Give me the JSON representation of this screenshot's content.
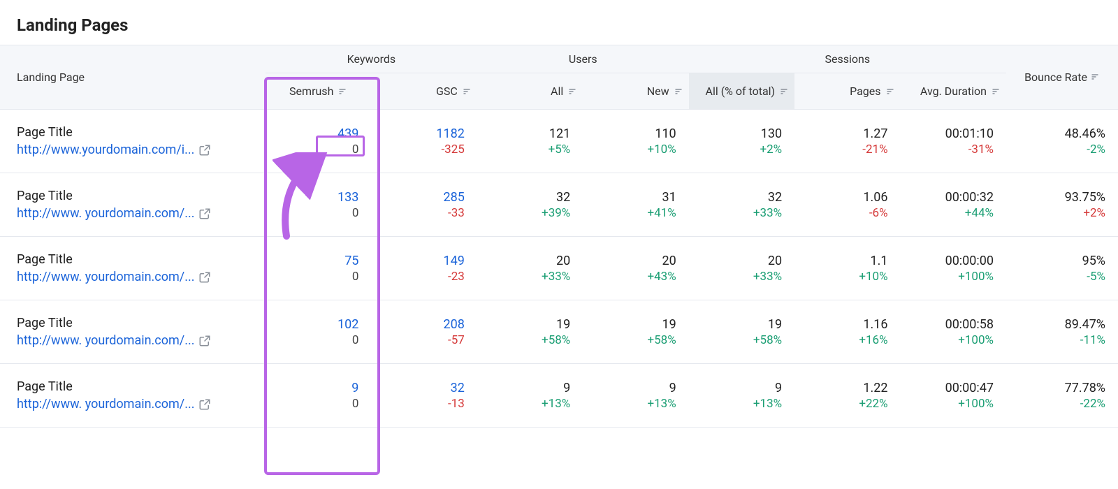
{
  "title": "Landing Pages",
  "headers": {
    "landing": "Landing Page",
    "keywords_group": "Keywords",
    "users_group": "Users",
    "sessions_group": "Sessions",
    "bounce": "Bounce Rate",
    "semrush": "Semrush",
    "gsc": "GSC",
    "users_all": "All",
    "users_new": "New",
    "sess_all": "All (% of total)",
    "sess_pages": "Pages",
    "sess_dur": "Avg. Duration"
  },
  "rows": [
    {
      "title": "Page Title",
      "url": "http://www.yourdomain.com/i...",
      "semrush": {
        "v": "439",
        "d": "0",
        "dc": "neutral"
      },
      "gsc": {
        "v": "1182",
        "d": "-325",
        "dc": "neg"
      },
      "users_all": {
        "v": "121",
        "d": "+5%",
        "dc": "pos"
      },
      "users_new": {
        "v": "110",
        "d": "+10%",
        "dc": "pos"
      },
      "sess_all": {
        "v": "130",
        "d": "+2%",
        "dc": "pos"
      },
      "pages": {
        "v": "1.27",
        "d": "-21%",
        "dc": "neg"
      },
      "dur": {
        "v": "00:01:10",
        "d": "-31%",
        "dc": "neg"
      },
      "bounce": {
        "v": "48.46%",
        "d": "-2%",
        "dc": "pos"
      }
    },
    {
      "title": "Page Title",
      "url": "http://www. yourdomain.com/...",
      "semrush": {
        "v": "133",
        "d": "0",
        "dc": "neutral"
      },
      "gsc": {
        "v": "285",
        "d": "-33",
        "dc": "neg"
      },
      "users_all": {
        "v": "32",
        "d": "+39%",
        "dc": "pos"
      },
      "users_new": {
        "v": "31",
        "d": "+41%",
        "dc": "pos"
      },
      "sess_all": {
        "v": "32",
        "d": "+33%",
        "dc": "pos"
      },
      "pages": {
        "v": "1.06",
        "d": "-6%",
        "dc": "neg"
      },
      "dur": {
        "v": "00:00:32",
        "d": "+44%",
        "dc": "pos"
      },
      "bounce": {
        "v": "93.75%",
        "d": "+2%",
        "dc": "neg"
      }
    },
    {
      "title": "Page Title",
      "url": "http://www. yourdomain.com/...",
      "semrush": {
        "v": "75",
        "d": "0",
        "dc": "neutral"
      },
      "gsc": {
        "v": "149",
        "d": "-23",
        "dc": "neg"
      },
      "users_all": {
        "v": "20",
        "d": "+33%",
        "dc": "pos"
      },
      "users_new": {
        "v": "20",
        "d": "+43%",
        "dc": "pos"
      },
      "sess_all": {
        "v": "20",
        "d": "+33%",
        "dc": "pos"
      },
      "pages": {
        "v": "1.1",
        "d": "+10%",
        "dc": "pos"
      },
      "dur": {
        "v": "00:00:00",
        "d": "+100%",
        "dc": "pos"
      },
      "bounce": {
        "v": "95%",
        "d": "-5%",
        "dc": "pos"
      }
    },
    {
      "title": "Page Title",
      "url": "http://www. yourdomain.com/...",
      "semrush": {
        "v": "102",
        "d": "0",
        "dc": "neutral"
      },
      "gsc": {
        "v": "208",
        "d": "-57",
        "dc": "neg"
      },
      "users_all": {
        "v": "19",
        "d": "+58%",
        "dc": "pos"
      },
      "users_new": {
        "v": "19",
        "d": "+58%",
        "dc": "pos"
      },
      "sess_all": {
        "v": "19",
        "d": "+58%",
        "dc": "pos"
      },
      "pages": {
        "v": "1.16",
        "d": "+16%",
        "dc": "pos"
      },
      "dur": {
        "v": "00:00:58",
        "d": "+100%",
        "dc": "pos"
      },
      "bounce": {
        "v": "89.47%",
        "d": "-11%",
        "dc": "pos"
      }
    },
    {
      "title": "Page Title",
      "url": "http://www. yourdomain.com/...",
      "semrush": {
        "v": "9",
        "d": "0",
        "dc": "neutral"
      },
      "gsc": {
        "v": "32",
        "d": "-13",
        "dc": "neg"
      },
      "users_all": {
        "v": "9",
        "d": "+13%",
        "dc": "pos"
      },
      "users_new": {
        "v": "9",
        "d": "+13%",
        "dc": "pos"
      },
      "sess_all": {
        "v": "9",
        "d": "+13%",
        "dc": "pos"
      },
      "pages": {
        "v": "1.22",
        "d": "+22%",
        "dc": "pos"
      },
      "dur": {
        "v": "00:00:47",
        "d": "+100%",
        "dc": "pos"
      },
      "bounce": {
        "v": "77.78%",
        "d": "-22%",
        "dc": "pos"
      }
    }
  ]
}
